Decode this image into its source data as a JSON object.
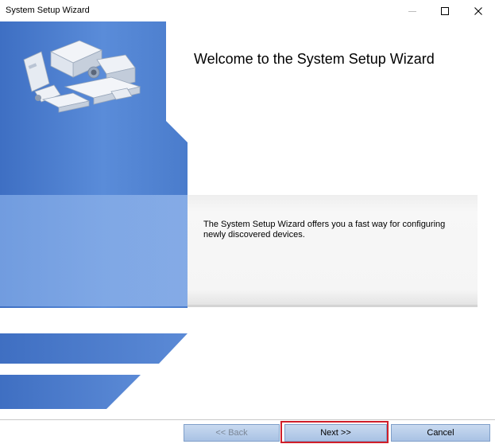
{
  "window": {
    "title": "System Setup Wizard",
    "controls": {
      "minimize": "minimize-icon",
      "maximize": "maximize-icon",
      "close": "close-icon"
    }
  },
  "main": {
    "heading": "Welcome to the System Setup Wizard",
    "description": "The System Setup Wizard offers you a fast way for configuring newly discovered devices."
  },
  "footer": {
    "back_label": "<< Back",
    "next_label": "Next >>",
    "cancel_label": "Cancel"
  },
  "colors": {
    "banner_blue": "#4f82d4",
    "banner_blue_dark": "#3c6bb8",
    "button_blue": "#b7cbe9",
    "highlight_red": "#d01f2a"
  }
}
